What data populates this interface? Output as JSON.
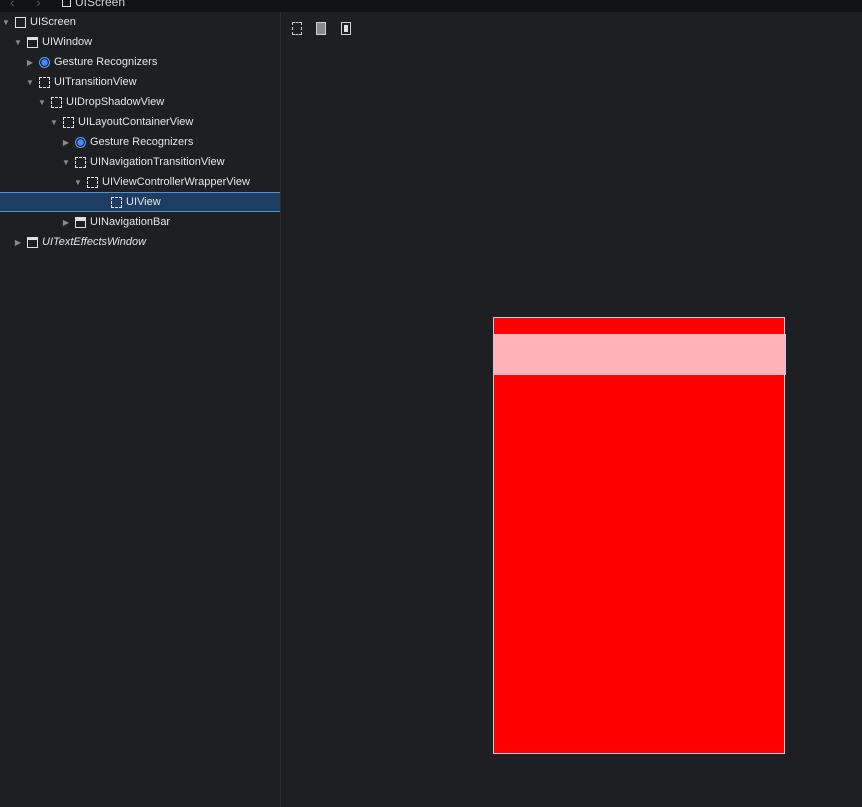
{
  "breadcrumb": {
    "label": "UIScreen"
  },
  "tree": [
    {
      "label": "UIScreen",
      "icon": "screen-icon",
      "disclosure": "expanded",
      "depth": 0
    },
    {
      "label": "UIWindow",
      "icon": "window-icon",
      "disclosure": "expanded",
      "depth": 1
    },
    {
      "label": "Gesture Recognizers",
      "icon": "gesture-icon",
      "disclosure": "collapsed",
      "depth": 2
    },
    {
      "label": "UITransitionView",
      "icon": "view-icon",
      "disclosure": "expanded",
      "depth": 2
    },
    {
      "label": "UIDropShadowView",
      "icon": "view-icon",
      "disclosure": "expanded",
      "depth": 3
    },
    {
      "label": "UILayoutContainerView",
      "icon": "view-icon",
      "disclosure": "expanded",
      "depth": 4
    },
    {
      "label": "Gesture Recognizers",
      "icon": "gesture-icon",
      "disclosure": "collapsed",
      "depth": 5
    },
    {
      "label": "UINavigationTransitionView",
      "icon": "view-icon",
      "disclosure": "expanded",
      "depth": 5
    },
    {
      "label": "UIViewControllerWrapperView",
      "icon": "view-icon",
      "disclosure": "expanded",
      "depth": 6
    },
    {
      "label": "UIView",
      "icon": "view-icon",
      "disclosure": "none",
      "depth": 8,
      "selected": true
    },
    {
      "label": "UINavigationBar",
      "icon": "navbar-icon",
      "disclosure": "collapsed",
      "depth": 5
    },
    {
      "label": "UITextEffectsWindow",
      "icon": "window-icon",
      "disclosure": "collapsed",
      "depth": 1,
      "italic": true
    }
  ],
  "toolbar": {
    "tools": [
      "wireframe-icon",
      "content-icon",
      "wireframe-content-icon"
    ]
  },
  "colors": {
    "device_fill": "#ff0000",
    "navbar_fill": "#ffb3b6",
    "selection": "#1e3d63",
    "gesture": "#3d8bff"
  }
}
